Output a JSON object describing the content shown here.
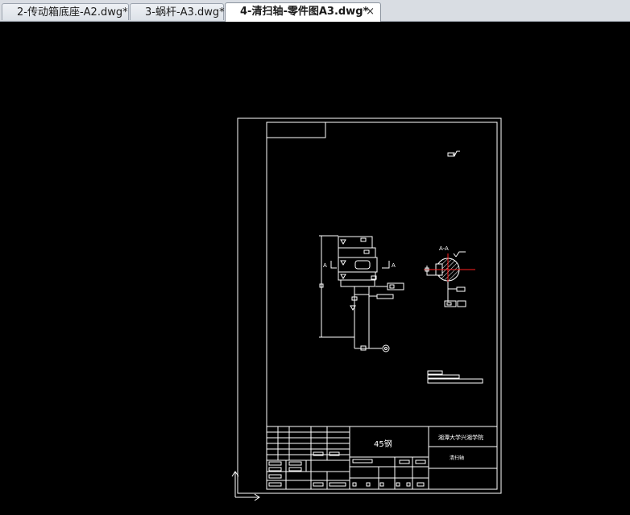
{
  "tabs": [
    {
      "label": "2-传动箱底座-A2.dwg*",
      "active": false
    },
    {
      "label": "3-蜗杆-A3.dwg*",
      "active": false
    },
    {
      "label": "4-清扫轴-零件图A3.dwg*",
      "active": true
    }
  ],
  "tab_close_glyph": "×",
  "drawing": {
    "section_label": "A-A",
    "section_marker_left": "A",
    "section_marker_right": "A",
    "title_block": {
      "material": "45钢",
      "school": "湘潭大学兴湘学院",
      "part_name": "清扫轴"
    }
  },
  "colors": {
    "background": "#000000",
    "lines": "#ffffff",
    "center_mark": "#ff2020"
  }
}
